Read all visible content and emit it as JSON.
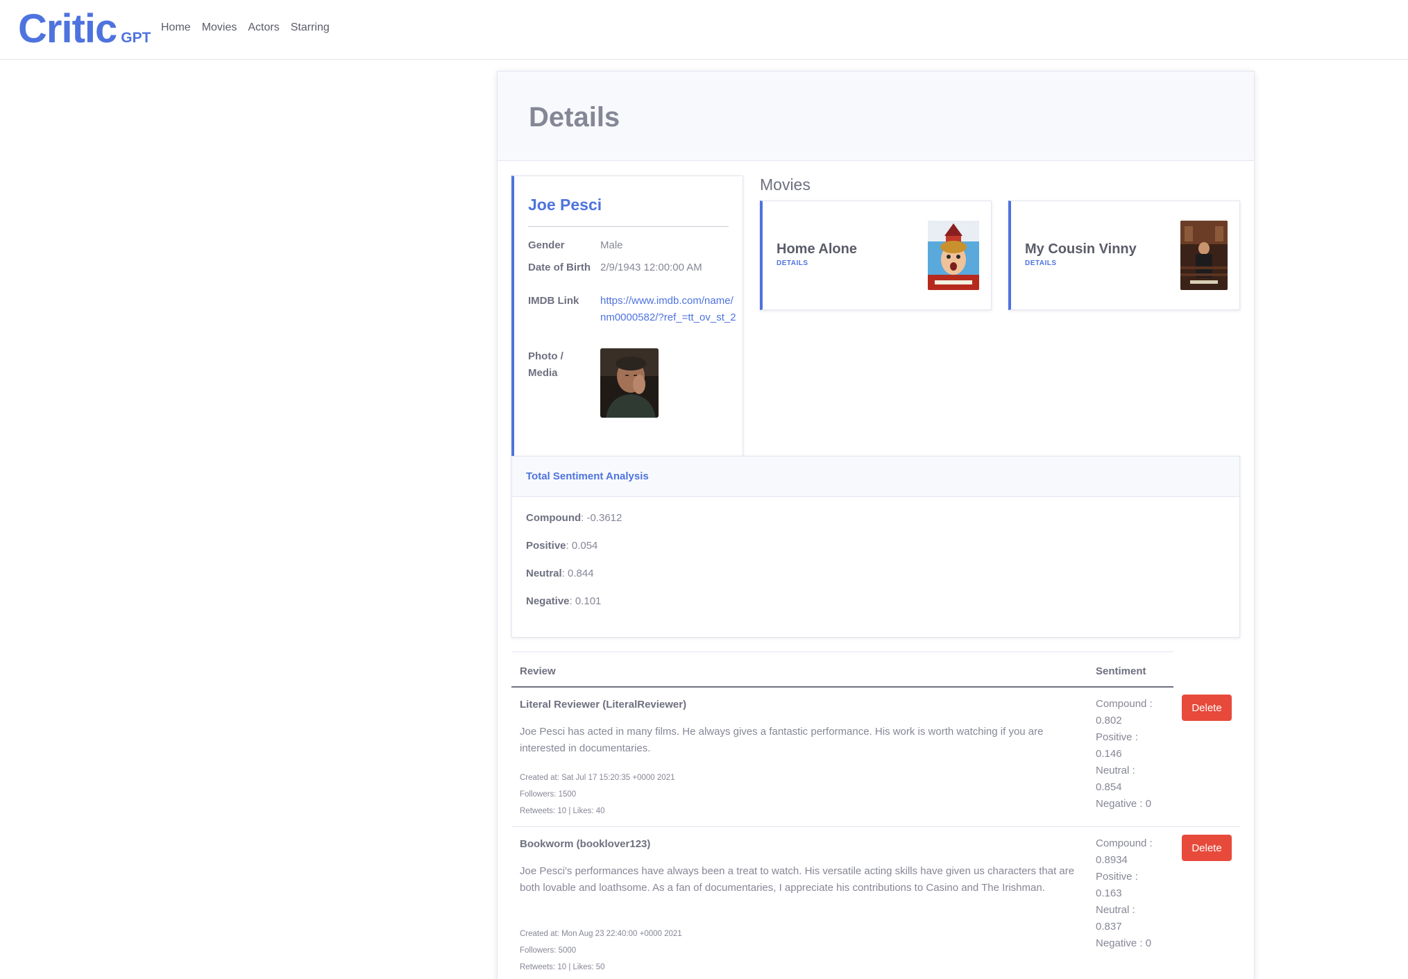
{
  "brand": {
    "name": "Critic",
    "suffix": "GPT"
  },
  "nav": {
    "links": [
      "Home",
      "Movies",
      "Actors",
      "Starring"
    ]
  },
  "page": {
    "title": "Details"
  },
  "actor": {
    "name": "Joe Pesci",
    "fields": {
      "gender_label": "Gender",
      "gender": "Male",
      "dob_label": "Date of Birth",
      "dob": "2/9/1943 12:00:00 AM",
      "imdb_label": "IMDB Link",
      "imdb": "https://www.imdb.com/name/nm0000582/?ref_=tt_ov_st_2",
      "photo_label": "Photo / Media"
    }
  },
  "movies": {
    "heading": "Movies",
    "items": [
      {
        "title": "Home Alone",
        "link": "DETAILS"
      },
      {
        "title": "My Cousin Vinny",
        "link": "DETAILS"
      }
    ]
  },
  "sentiment": {
    "title": "Total Sentiment Analysis",
    "rows": [
      {
        "label": "Compound",
        "value": ": -0.3612"
      },
      {
        "label": "Positive",
        "value": ": 0.054"
      },
      {
        "label": "Neutral",
        "value": ": 0.844"
      },
      {
        "label": "Negative",
        "value": ": 0.101"
      }
    ]
  },
  "reviews": {
    "headers": {
      "review": "Review",
      "sentiment": "Sentiment"
    },
    "delete_label": "Delete",
    "items": [
      {
        "author": "Literal Reviewer (LiteralReviewer)",
        "text": "Joe Pesci has acted in many films. He always gives a fantastic performance. His work is worth watching if you are interested in documentaries.",
        "created": "Created at: Sat Jul 17 15:20:35 +0000 2021",
        "followers": "Followers: 1500",
        "engagement": "Retweets: 10 | Likes: 40",
        "sentiment": [
          "Compound :",
          "0.802",
          "Positive :",
          "0.146",
          "Neutral :",
          "0.854",
          "Negative : 0"
        ]
      },
      {
        "author": "Bookworm (booklover123)",
        "text": "Joe Pesci's performances have always been a treat to watch. His versatile acting skills have given us characters that are both lovable and loathsome. As a fan of documentaries, I appreciate his contributions to Casino and The Irishman.",
        "created": "Created at: Mon Aug 23 22:40:00 +0000 2021",
        "followers": "Followers: 5000",
        "engagement": "Retweets: 10 | Likes: 50",
        "sentiment": [
          "Compound :",
          "0.8934",
          "Positive :",
          "0.163",
          "Neutral :",
          "0.837",
          "Negative : 0"
        ]
      }
    ]
  },
  "colors": {
    "primary": "#4e73df",
    "danger": "#e74a3b",
    "muted": "#858796"
  }
}
